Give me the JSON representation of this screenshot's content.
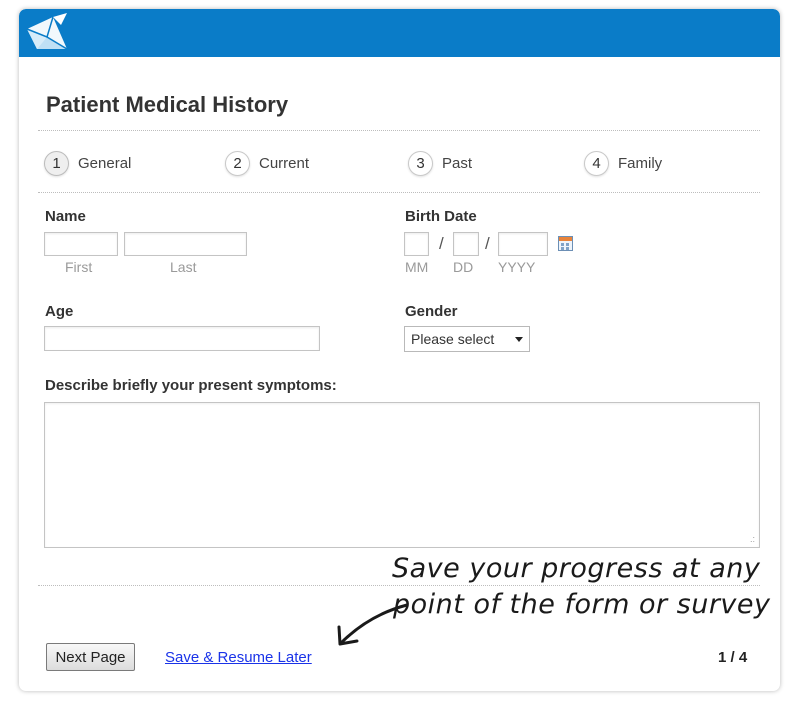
{
  "form": {
    "title": "Patient Medical History",
    "steps": [
      {
        "number": "1",
        "label": "General",
        "active": true
      },
      {
        "number": "2",
        "label": "Current",
        "active": false
      },
      {
        "number": "3",
        "label": "Past",
        "active": false
      },
      {
        "number": "4",
        "label": "Family",
        "active": false
      }
    ],
    "name": {
      "label": "Name",
      "first_sub": "First",
      "last_sub": "Last",
      "first_value": "",
      "last_value": ""
    },
    "birth_date": {
      "label": "Birth Date",
      "separator": "/",
      "mm_sub": "MM",
      "dd_sub": "DD",
      "yyyy_sub": "YYYY",
      "calendar_icon": "calendar-icon"
    },
    "age": {
      "label": "Age",
      "value": ""
    },
    "gender": {
      "label": "Gender",
      "selected": "Please select"
    },
    "symptoms": {
      "label": "Describe briefly your present symptoms:",
      "value": ""
    },
    "annotation": {
      "line1": "Save your progress at any",
      "line2": "point of the form or survey"
    },
    "footer": {
      "next_label": "Next Page",
      "save_label": "Save & Resume Later",
      "page_indicator": "1 / 4"
    }
  },
  "colors": {
    "header_bar": "#0a7cc8",
    "link": "#1a33e8"
  }
}
